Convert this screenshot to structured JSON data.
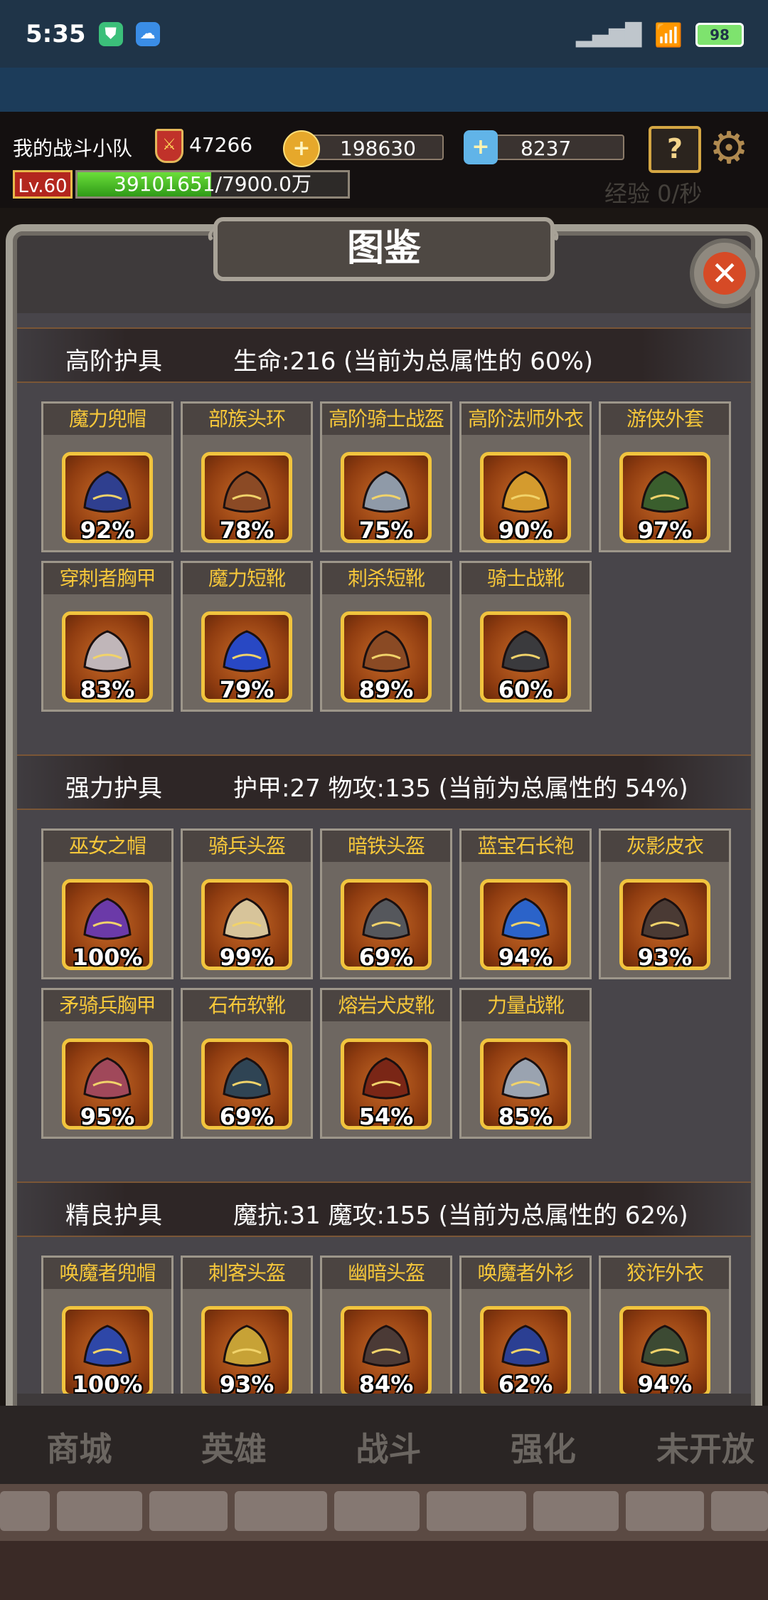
{
  "status_bar": {
    "time": "5:35",
    "battery": "98"
  },
  "header": {
    "team_name": "我的战斗小队",
    "power": "47266",
    "gold": "198630",
    "gems": "8237",
    "level": "Lv.60",
    "exp_current": "39101651",
    "exp_total": "/7900.0万",
    "exp_progress": 0.495,
    "exp_rate": "经验 0/秒"
  },
  "panel": {
    "title": "图鉴"
  },
  "sections": [
    {
      "name": "高阶护具",
      "stat": "生命:216 (当前为总属性的 60%)",
      "items": [
        {
          "label": "魔力兜帽",
          "pct": "92%",
          "color": "#2f3f8f"
        },
        {
          "label": "部族头环",
          "pct": "78%",
          "color": "#8b4a25"
        },
        {
          "label": "高阶骑士战盔",
          "pct": "75%",
          "color": "#8f9aa8"
        },
        {
          "label": "高阶法师外衣",
          "pct": "90%",
          "color": "#d49b2e"
        },
        {
          "label": "游侠外套",
          "pct": "97%",
          "color": "#3a5e2d"
        },
        {
          "label": "穿刺者胸甲",
          "pct": "83%",
          "color": "#c0b6b9"
        },
        {
          "label": "魔力短靴",
          "pct": "79%",
          "color": "#2848c4"
        },
        {
          "label": "刺杀短靴",
          "pct": "89%",
          "color": "#8a4a24"
        },
        {
          "label": "骑士战靴",
          "pct": "60%",
          "color": "#3a3a3d"
        }
      ]
    },
    {
      "name": "强力护具",
      "stat": "护甲:27  物攻:135 (当前为总属性的 54%)",
      "items": [
        {
          "label": "巫女之帽",
          "pct": "100%",
          "color": "#6b3aa8"
        },
        {
          "label": "骑兵头盔",
          "pct": "99%",
          "color": "#d7c49a"
        },
        {
          "label": "暗铁头盔",
          "pct": "69%",
          "color": "#55575c"
        },
        {
          "label": "蓝宝石长袍",
          "pct": "94%",
          "color": "#2b63c9"
        },
        {
          "label": "灰影皮衣",
          "pct": "93%",
          "color": "#4a3a34"
        },
        {
          "label": "矛骑兵胸甲",
          "pct": "95%",
          "color": "#a0485a"
        },
        {
          "label": "石布软靴",
          "pct": "69%",
          "color": "#2f4454"
        },
        {
          "label": "熔岩犬皮靴",
          "pct": "54%",
          "color": "#7a2616"
        },
        {
          "label": "力量战靴",
          "pct": "85%",
          "color": "#9aa3b0"
        }
      ]
    },
    {
      "name": "精良护具",
      "stat": "魔抗:31  魔攻:155 (当前为总属性的 62%)",
      "items": [
        {
          "label": "唤魔者兜帽",
          "pct": "100%",
          "color": "#2e47a8"
        },
        {
          "label": "刺客头盔",
          "pct": "93%",
          "color": "#c7a236"
        },
        {
          "label": "幽暗头盔",
          "pct": "84%",
          "color": "#4b3a36"
        },
        {
          "label": "唤魔者外衫",
          "pct": "62%",
          "color": "#2b3f93"
        },
        {
          "label": "狡诈外衣",
          "pct": "94%",
          "color": "#3c4a33"
        }
      ]
    }
  ],
  "bottom_nav": [
    "商城",
    "英雄",
    "战斗",
    "强化",
    "未开放"
  ]
}
